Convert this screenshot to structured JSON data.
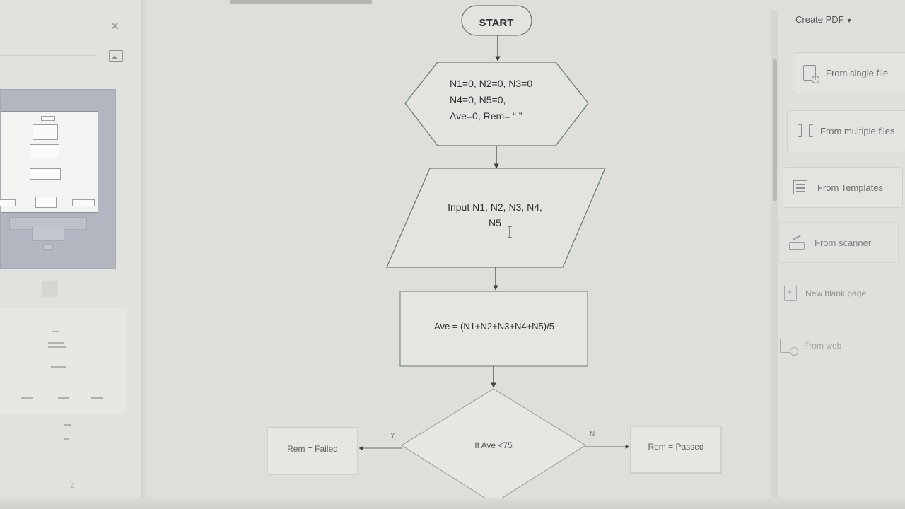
{
  "left_panel": {
    "close_label": "×",
    "icons": {
      "close": "close-icon",
      "insert_image": "image-icon"
    },
    "page_number": "2"
  },
  "flowchart": {
    "start": "START",
    "init_lines": [
      "N1=0, N2=0, N3=0",
      "N4=0, N5=0,",
      "Ave=0, Rem= “ ”"
    ],
    "input_lines": [
      "Input N1, N2, N3, N4,",
      "N5"
    ],
    "process": "Ave = (N1+N2+N3+N4+N5)/5",
    "decision": "If Ave <75",
    "yes_label": "Y",
    "no_label": "N",
    "yes_result": "Rem = Failed",
    "no_result": "Rem = Passed"
  },
  "right_panel": {
    "header": "Create PDF",
    "items": [
      {
        "label": "From single file",
        "icon": "document-plus-icon"
      },
      {
        "label": "From multiple files",
        "icon": "merge-files-icon"
      },
      {
        "label": "From Templates",
        "icon": "template-icon"
      },
      {
        "label": "From scanner",
        "icon": "scanner-icon"
      },
      {
        "label": "New blank page",
        "icon": "blank-page-icon"
      },
      {
        "label": "From web",
        "icon": "web-page-icon"
      }
    ]
  },
  "colors": {
    "background": "#dedfda",
    "shape_stroke": "#7f8a86",
    "text": "#2e3134"
  }
}
